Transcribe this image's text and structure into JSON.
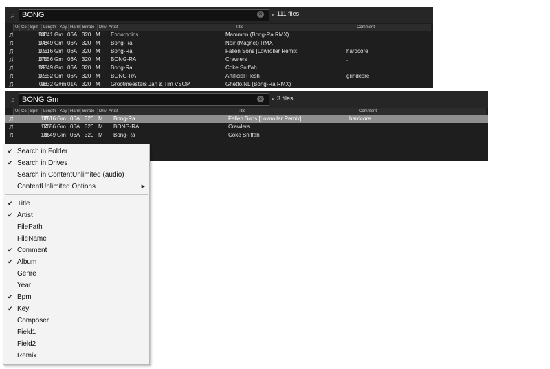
{
  "panel1": {
    "search_value": "BONG",
    "file_count": "111 files",
    "columns": [
      "Us",
      "Col",
      "Bpm",
      "Length",
      "Key",
      "Harmo",
      "Bitrate",
      "Drive",
      "Artist",
      "Title",
      "Comment"
    ],
    "rows": [
      [
        "100",
        "04:41",
        "Gm",
        "06A",
        "320",
        "M",
        "Endorphins",
        "Mammon (Bong-Ra RMX)",
        ""
      ],
      [
        "173",
        "04:49",
        "Gm",
        "06A",
        "320",
        "M",
        "Bong-Ra",
        "Noir (Magnet) RMX",
        ""
      ],
      [
        "175",
        "05:16",
        "Gm",
        "06A",
        "320",
        "M",
        "Bong-Ra",
        "Fallen Sons [Lowroller Remix]",
        "hardcore"
      ],
      [
        "175",
        "04:56",
        "Gm",
        "06A",
        "320",
        "M",
        "BONG-RA",
        "Crawlers",
        "."
      ],
      [
        "195",
        "05:49",
        "Gm",
        "06A",
        "320",
        "M",
        "Bong-Ra",
        "Coke Sniffah",
        ""
      ],
      [
        "175",
        "05:52",
        "Gm",
        "06A",
        "320",
        "M",
        "BONG-RA",
        "Artificial Flesh",
        "grindcore"
      ],
      [
        "93",
        "03:32",
        "G#m",
        "01A",
        "320",
        "M",
        "Grootmeesters Jan & Tim VSOP",
        "Ghetto.NL (Bong-Ra RMX)",
        ""
      ]
    ]
  },
  "panel2": {
    "search_value": "BONG Gm",
    "file_count": "3 files",
    "columns": [
      "Us",
      "Col",
      "Bpm",
      "Length",
      "Key",
      "Harmo",
      "Bitrate",
      "Drive",
      "Artist",
      "Title",
      "Comment"
    ],
    "rows": [
      [
        "175",
        "05:16",
        "Gm",
        "06A",
        "320",
        "M",
        "Bong-Ra",
        "Fallen Sons [Lowroller Remix]",
        "hardcore"
      ],
      [
        "175",
        "04:56",
        "Gm",
        "06A",
        "320",
        "M",
        "BONG-RA",
        "Crawlers",
        "."
      ],
      [
        "195",
        "05:49",
        "Gm",
        "06A",
        "320",
        "M",
        "Bong-Ra",
        "Coke Sniffah",
        ""
      ]
    ],
    "selected_row": 0
  },
  "search_menu": {
    "scope_items": [
      {
        "label": "Search in Folder",
        "checked": true
      },
      {
        "label": "Search in Drives",
        "checked": true
      },
      {
        "label": "Search in ContentUnlimited (audio)",
        "checked": false
      },
      {
        "label": "ContentUnlimited Options",
        "checked": false,
        "submenu": true
      }
    ],
    "field_items": [
      {
        "label": "Title",
        "checked": true
      },
      {
        "label": "Artist",
        "checked": true
      },
      {
        "label": "FilePath",
        "checked": false
      },
      {
        "label": "FileName",
        "checked": false
      },
      {
        "label": "Comment",
        "checked": true
      },
      {
        "label": "Album",
        "checked": true
      },
      {
        "label": "Genre",
        "checked": false
      },
      {
        "label": "Year",
        "checked": false
      },
      {
        "label": "Bpm",
        "checked": true
      },
      {
        "label": "Key",
        "checked": true
      },
      {
        "label": "Composer",
        "checked": false
      },
      {
        "label": "Field1",
        "checked": false
      },
      {
        "label": "Field2",
        "checked": false
      },
      {
        "label": "Remix",
        "checked": false
      }
    ]
  },
  "icons": {
    "search": "search-icon",
    "clear": "clear-search-icon",
    "track": "music-note-icon",
    "check": "checkmark-icon",
    "submenu": "submenu-arrow-icon"
  }
}
